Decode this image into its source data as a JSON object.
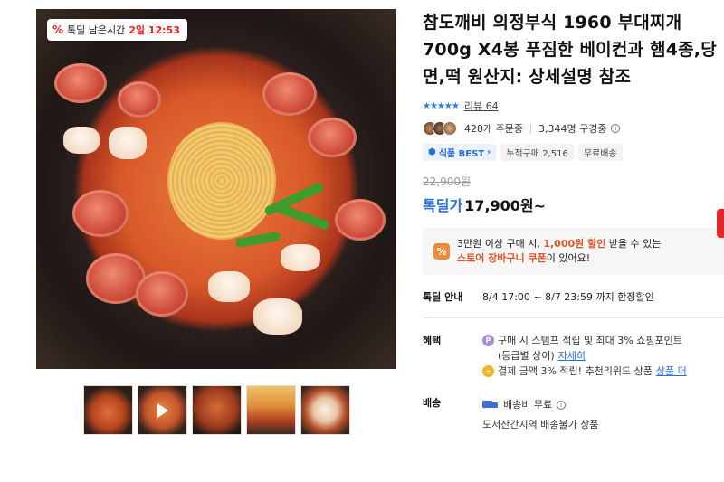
{
  "gallery": {
    "timer_badge": {
      "icon": "percent-tag-icon",
      "label": "톡딜 남은시간",
      "time": "2일 12:53"
    },
    "thumbnails": [
      {
        "icon": "photo"
      },
      {
        "icon": "play-icon"
      },
      {
        "icon": "photo"
      },
      {
        "icon": "photo"
      },
      {
        "icon": "photo"
      }
    ]
  },
  "product": {
    "title": "참도깨비 의정부식 1960 부대찌개 700g X4봉 푸짐한 베이컨과 햄4종,당면,떡 원산지: 상세설명 참조",
    "stars": "★★★★★",
    "review_label": "리뷰 64",
    "orders": "428개 주문중",
    "reviewers": "3,344명 구경중",
    "tags": {
      "best": "식품 BEST",
      "sold": "누적구매 2,516",
      "free_ship": "무료배송"
    },
    "original_price": "22,900원",
    "price_label": "톡딜가",
    "price": "17,900원~"
  },
  "coupon": {
    "line1_a": "3만원 이상 구매 시, ",
    "line1_hl": "1,000원 할인",
    "line1_b": " 받을 수 있는",
    "line2_hl": "스토어 장바구니 쿠폰",
    "line2_b": "이 있어요!"
  },
  "deal": {
    "label": "톡딜 안내",
    "value": "8/4 17:00 ~ 8/7 23:59 까지 한정할인"
  },
  "benefit": {
    "label": "혜택",
    "line1": "구매 시 스탬프 적립 및 최대 3% 쇼핑포인트",
    "line2_a": "(등급별 상이) ",
    "line2_link": "자세히",
    "line3_a": "결제 금액 3% 적립! 추천리워드 상품 ",
    "line3_link": "상품 더"
  },
  "shipping": {
    "label": "배송",
    "fee": "배송비 무료",
    "note": "도서산간지역 배송불가 상품"
  },
  "colors": {
    "accent_blue": "#2c6fd6",
    "sale_red": "#e52528",
    "coupon_orange": "#e0552a"
  }
}
